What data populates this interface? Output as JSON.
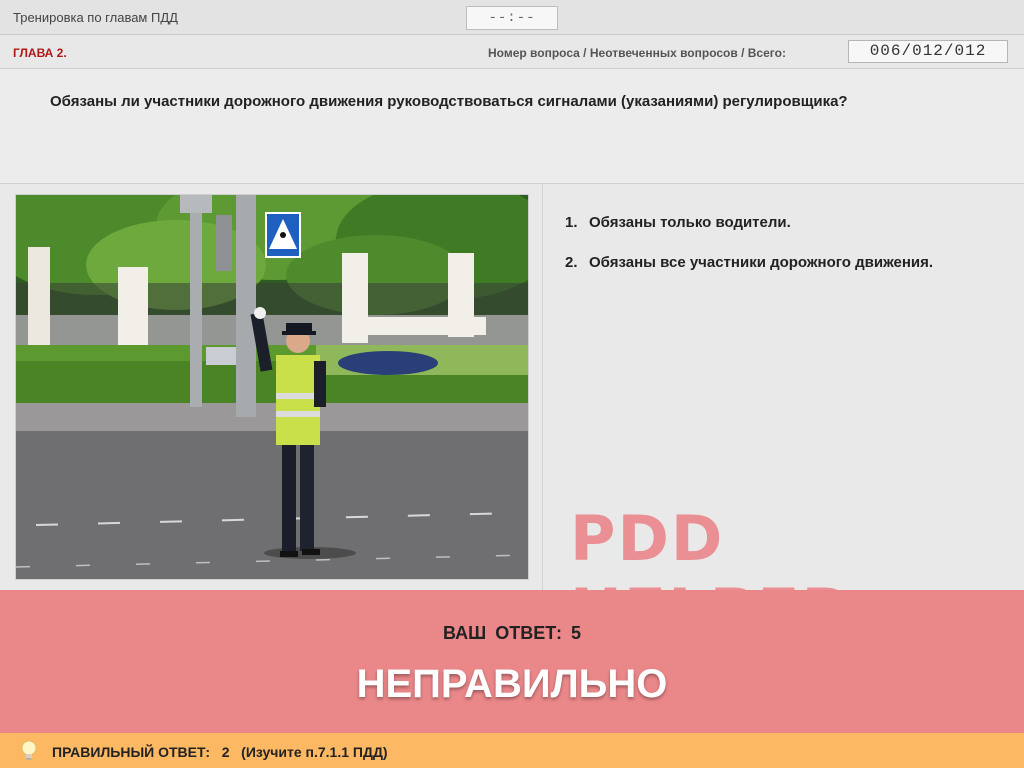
{
  "header": {
    "title": "Тренировка по главам ПДД",
    "timer": "--:--"
  },
  "chapter_bar": {
    "chapter": "ГЛАВА 2.",
    "counter_label": "Номер вопроса / Неотвеченных вопросов / Всего:",
    "counter": "006/012/012"
  },
  "question": {
    "text": "Обязаны ли участники дорожного движения руководствоваться сигналами (указаниями) регулировщика?"
  },
  "image": {
    "description_icon": "traffic-controller-photo"
  },
  "answers": [
    {
      "num": "1.",
      "text": "Обязаны только водители."
    },
    {
      "num": "2.",
      "text": "Обязаны все участники дорожного движения."
    }
  ],
  "watermark": "PDD HELPER",
  "result": {
    "your_answer": "ВАШ ОТВЕТ: 5",
    "verdict": "НЕПРАВИЛЬНО"
  },
  "hint": {
    "icon": "lightbulb-icon",
    "text": "ПРАВИЛЬНЫЙ ОТВЕТ:   2   (Изучите п.7.1.1 ПДД)"
  },
  "colors": {
    "chapter": "#b01818",
    "result_bg": "#ea8789",
    "hint_bg": "#fdb863",
    "watermark": "#eb8c90"
  }
}
